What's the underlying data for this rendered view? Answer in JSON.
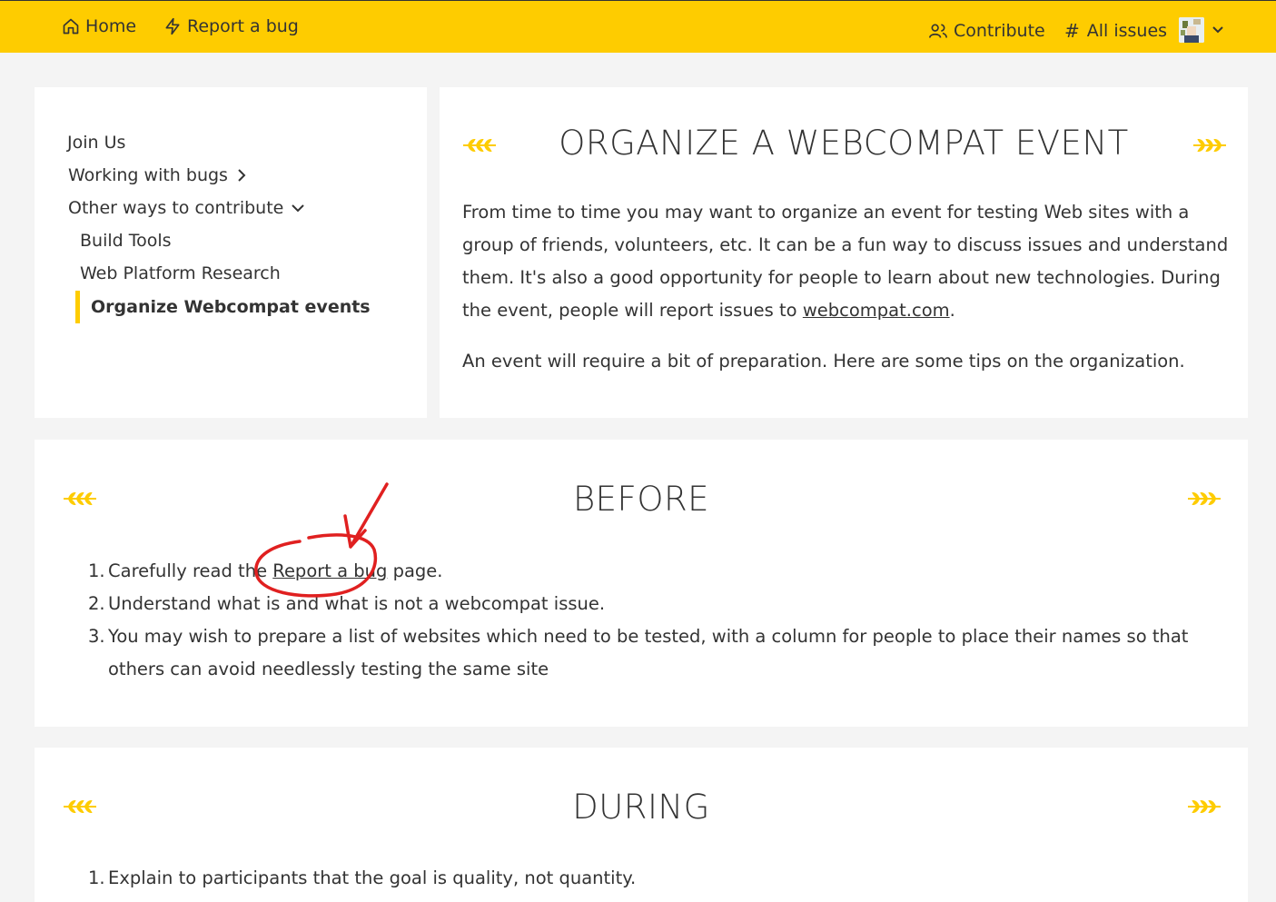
{
  "nav": {
    "home": "Home",
    "report": "Report a bug",
    "contribute": "Contribute",
    "issues": "All issues",
    "issues_prefix": "#"
  },
  "sidebar": {
    "join": "Join Us",
    "working": "Working with bugs",
    "other": "Other ways to contribute",
    "build": "Build Tools",
    "research": "Web Platform Research",
    "organize": "Organize Webcompat events"
  },
  "main": {
    "title": "ORGANIZE A WEBCOMPAT EVENT",
    "intro_before": "From time to time you may want to organize an event for testing Web sites with a group of friends, volunteers, etc. It can be a fun way to discuss issues and understand them. It's also a good opportunity for people to learn about new technologies. During the event, people will report issues to ",
    "intro_link": "webcompat.com",
    "intro_after": ".",
    "prep": "An event will require a bit of preparation. Here are some tips on the organization."
  },
  "before": {
    "title": "BEFORE",
    "item1_before": "Carefully read the ",
    "item1_link": "Report a bug",
    "item1_after": " page.",
    "item2": "Understand what is and what is not a webcompat issue.",
    "item3": "You may wish to prepare a list of websites which need to be tested, with a column for people to place their names so that others can avoid needlessly testing the same site"
  },
  "during": {
    "title": "DURING",
    "item1": "Explain to participants that the goal is quality, not quantity."
  },
  "colors": {
    "accent": "#fecc00",
    "annotation": "#e02020"
  }
}
